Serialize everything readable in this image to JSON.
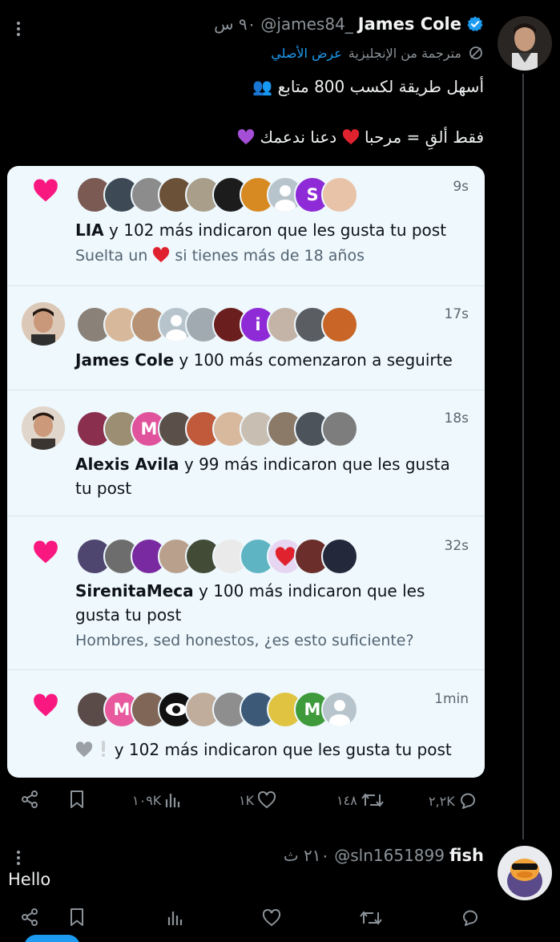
{
  "tweet": {
    "author_name": "James Cole",
    "handle": "@james84_",
    "time": "٩٠ س",
    "translated_label": "مترجمة من الإنجليزية",
    "view_original": "عرض الأصلي",
    "line1": "أسهل طريقة لكسب 800 متابع",
    "line2": "فقط ألقِ = مرحبا",
    "line2b": "دعنا ندعمك"
  },
  "card": {
    "notifications": [
      {
        "type": "like",
        "time": "9s",
        "actor": "LIA",
        "text": " y 102 más indicaron que les gusta tu post",
        "sub_a": "Suelta un ",
        "sub_b": " si tienes más de 18 años"
      },
      {
        "type": "follow",
        "time": "17s",
        "actor": "James Cole",
        "text": " y 100 más comenzaron a seguirte"
      },
      {
        "type": "like",
        "time": "18s",
        "actor": "Alexis Avila",
        "text": " y 99 más indicaron que les gusta tu post"
      },
      {
        "type": "like",
        "time": "32s",
        "actor": "SirenitaMeca",
        "text": " y 100 más indicaron que les gusta tu post",
        "sub": "Hombres, sed honestos, ¿es esto suficiente?"
      },
      {
        "type": "like",
        "time": "1min",
        "actor": "",
        "text": "y 102 más indicaron que les gusta tu post"
      }
    ]
  },
  "tweet_actions": {
    "views": "١٠٩K",
    "likes": "١K",
    "retweets": "١٤٨",
    "replies": "٢,٢K"
  },
  "reply": {
    "author_name": "fish",
    "handle": "@sln1651899",
    "time": "٢١٠ ث",
    "text": "Hello"
  },
  "colors": {
    "background": "#000000",
    "card_bg": "#eef8fd",
    "heart": "#f91880",
    "accent": "#1d9bf0"
  },
  "icons": [
    "share-icon",
    "bookmark-icon",
    "views-icon",
    "like-icon",
    "retweet-icon",
    "reply-icon",
    "verified-icon",
    "translate-icon",
    "more-icon"
  ]
}
